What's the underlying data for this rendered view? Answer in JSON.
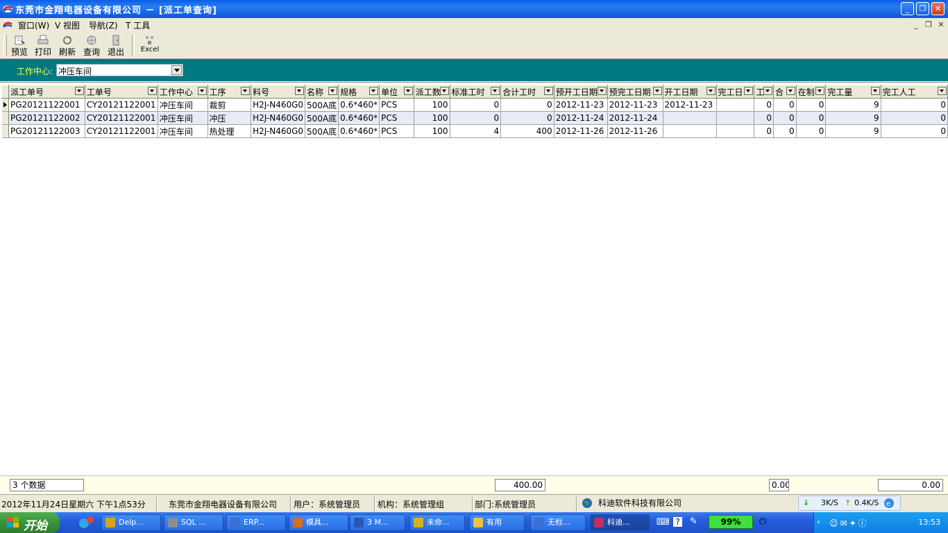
{
  "window": {
    "title": "东莞市金翔电器设备有限公司 － [派工单查询]",
    "controls": {
      "minimize": "_",
      "restore": "❐",
      "close": "✕"
    }
  },
  "menu": {
    "items": [
      {
        "label": "窗口(W)"
      },
      {
        "label": "V 视图"
      },
      {
        "label": "导航(Z)"
      },
      {
        "label": "T 工具"
      }
    ],
    "mdi_controls": {
      "minimize": "_",
      "restore": "❐",
      "close": "✕"
    }
  },
  "toolbar": {
    "preview": "预览",
    "print": "打印",
    "refresh": "刷新",
    "query": "查询",
    "exit": "退出",
    "excel": "Excel"
  },
  "filter": {
    "label": "工作中心:",
    "work_center": "冲压车间"
  },
  "grid": {
    "columns": [
      "派工单号",
      "工单号",
      "工作中心",
      "工序",
      "料号",
      "名称",
      "规格",
      "单位",
      "派工数",
      "标准工时",
      "合计工时",
      "预开工日期",
      "预完工日期",
      "开工日期",
      "完工日",
      "工",
      "合",
      "在制",
      "完工量",
      "完工人工"
    ],
    "rows": [
      [
        "PG20121122001",
        "CY20121122001",
        "冲压车间",
        "裁剪",
        "H2J-N460G0",
        "500A底",
        "0.6*460*",
        "PCS",
        "100",
        "0",
        "0",
        "2012-11-23",
        "2012-11-23",
        "2012-11-23",
        "",
        "0",
        "0",
        "0",
        "9",
        "0"
      ],
      [
        "PG20121122002",
        "CY20121122001",
        "冲压车间",
        "冲压",
        "H2J-N460G0",
        "500A底",
        "0.6*460*",
        "PCS",
        "100",
        "0",
        "0",
        "2012-11-24",
        "2012-11-24",
        "",
        "",
        "0",
        "0",
        "0",
        "9",
        "0"
      ],
      [
        "PG20121122003",
        "CY20121122001",
        "冲压车间",
        "热处理",
        "H2J-N460G0",
        "500A底",
        "0.6*460*",
        "PCS",
        "100",
        "4",
        "400",
        "2012-11-26",
        "2012-11-26",
        "",
        "",
        "0",
        "0",
        "0",
        "9",
        "0"
      ]
    ]
  },
  "summary": {
    "count": "3 个数据",
    "total_hours": "400.00",
    "sum_small": "0.00",
    "sum_labor": "0.00"
  },
  "status": {
    "datetime": "2012年11月24日星期六  下午1点53分",
    "company": "东莞市金翔电器设备有限公司",
    "user": "用户：系统管理员",
    "org": "机构：系统管理组",
    "dept": "部门:系统管理员",
    "vendor": "科迪软件科技有限公司"
  },
  "netspeed": {
    "down": "3K/S",
    "up": "0.4K/S"
  },
  "taskbar": {
    "start": "开始",
    "tasks": [
      {
        "label": "Delp..."
      },
      {
        "label": "SQL ..."
      },
      {
        "label": "ERP..."
      },
      {
        "label": "模具..."
      },
      {
        "label": "3 M..."
      },
      {
        "label": "未命..."
      },
      {
        "label": "有用"
      },
      {
        "label": "无标..."
      },
      {
        "label": "科迪..."
      }
    ],
    "battery": "99%",
    "clock": "13:53"
  },
  "colors": {
    "titlebar": "#0a5ee8",
    "filter_bg": "#007a80",
    "filter_label": "#ffff55",
    "row_alt": "#e6ecf6",
    "taskbar": "#245edb",
    "start": "#3b923b"
  }
}
